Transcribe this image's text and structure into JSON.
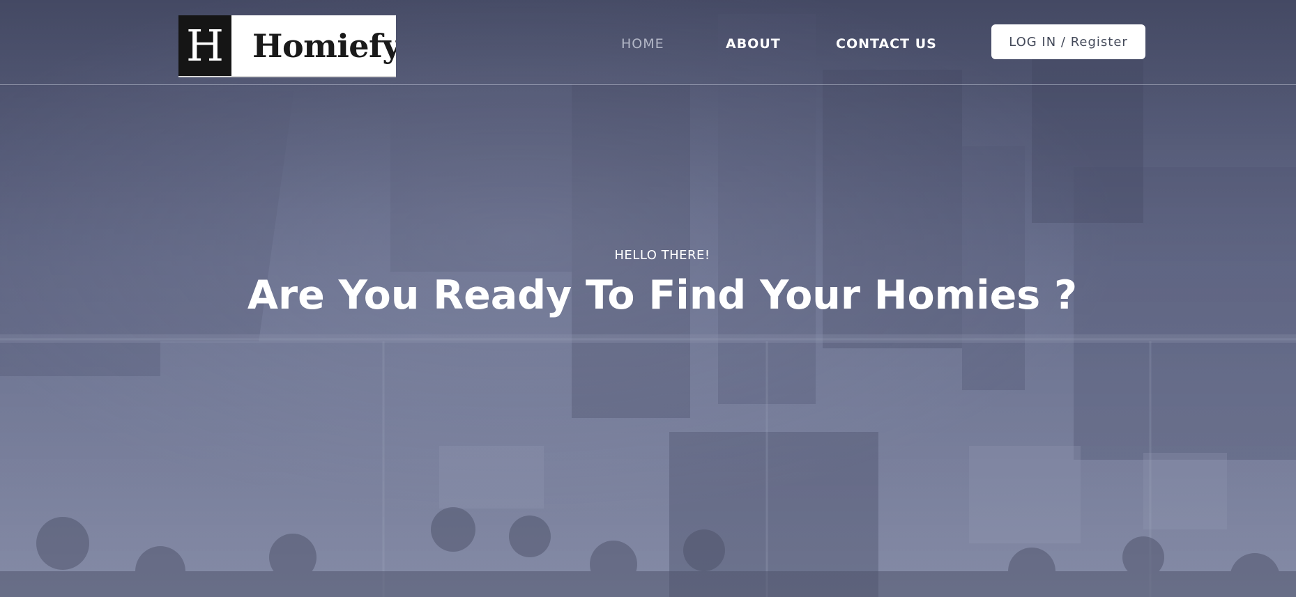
{
  "brand": {
    "logo_mark": "H",
    "logo_text": "Homiefy"
  },
  "nav": {
    "items": [
      {
        "label": "HOME",
        "active": true
      },
      {
        "label": "ABOUT",
        "active": false
      },
      {
        "label": "CONTACT US",
        "active": false
      }
    ],
    "login_label": "LOG IN / Register"
  },
  "hero": {
    "eyebrow": "HELLO THERE!",
    "title": "Are You Ready To Find Your Homies ?"
  },
  "colors": {
    "overlay": "#5c6280",
    "nav_active": "#b3b7c7",
    "nav_text": "#ffffff",
    "button_bg": "#ffffff",
    "button_text": "#444a5a"
  }
}
